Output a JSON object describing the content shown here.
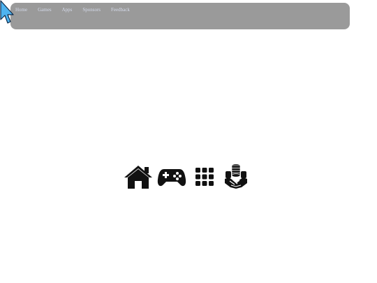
{
  "nav": {
    "items": [
      {
        "label": "Home"
      },
      {
        "label": "Games"
      },
      {
        "label": "Apps"
      },
      {
        "label": "Sponsors"
      },
      {
        "label": "Feedback"
      }
    ]
  },
  "icons": [
    {
      "name": "home-icon"
    },
    {
      "name": "gamepad-icon"
    },
    {
      "name": "apps-grid-icon"
    },
    {
      "name": "sponsors-icon"
    }
  ],
  "colors": {
    "nav_background": "#9a9a9a",
    "nav_link": "#d6dcec",
    "icon": "#111111",
    "cursor": "#4fb3ef"
  }
}
